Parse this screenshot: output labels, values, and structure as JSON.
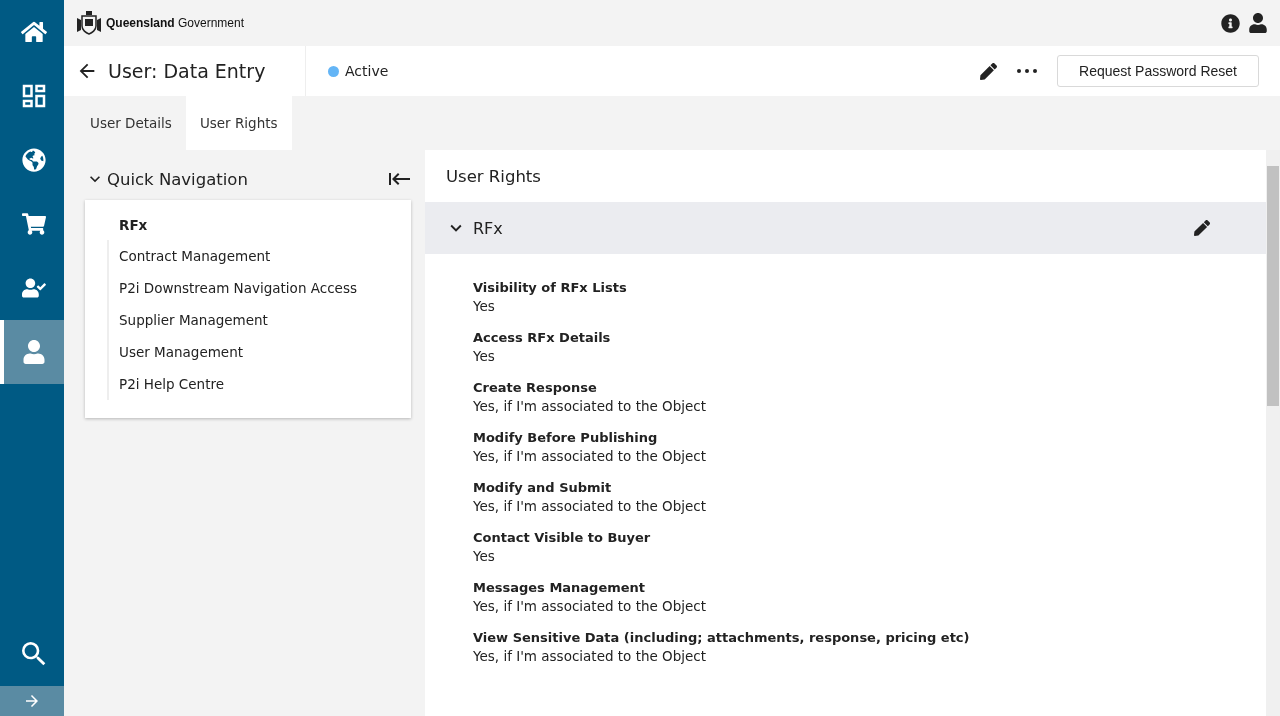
{
  "rail": {
    "items": [
      {
        "kind": "home",
        "selected": false
      },
      {
        "kind": "layout",
        "selected": false
      },
      {
        "kind": "globe",
        "selected": false
      },
      {
        "kind": "cart",
        "selected": false
      },
      {
        "kind": "user-check",
        "selected": false
      },
      {
        "kind": "user",
        "selected": true
      }
    ],
    "bottom": [
      {
        "kind": "search"
      }
    ]
  },
  "topbar": {
    "logo": "**Queensland** Government"
  },
  "header": {
    "title": "User: Data Entry",
    "status": "Active",
    "button": "Request Password Reset"
  },
  "tabs": [
    {
      "label": "User Details",
      "selected": false
    },
    {
      "label": "User Rights",
      "selected": true
    }
  ],
  "quick_nav": {
    "title": "Quick Navigation",
    "items": [
      {
        "label": "RFx",
        "selected": true
      },
      {
        "label": "Contract Management",
        "selected": false
      },
      {
        "label": "P2i Downstream Navigation Access",
        "selected": false
      },
      {
        "label": "Supplier Management",
        "selected": false
      },
      {
        "label": "User Management",
        "selected": false
      },
      {
        "label": "P2i Help Centre",
        "selected": false
      }
    ]
  },
  "panel": {
    "title": "User Rights",
    "section": {
      "title": "RFx",
      "expanded": true,
      "fields": [
        {
          "label": "Visibility of RFx Lists",
          "value": "Yes"
        },
        {
          "label": "Access RFx Details",
          "value": "Yes"
        },
        {
          "label": "Create Response",
          "value": "Yes, if I'm associated to the Object"
        },
        {
          "label": "Modify Before Publishing",
          "value": "Yes, if I'm associated to the Object"
        },
        {
          "label": "Modify and Submit",
          "value": "Yes, if I'm associated to the Object"
        },
        {
          "label": "Contact Visible to Buyer",
          "value": "Yes"
        },
        {
          "label": "Messages Management",
          "value": "Yes, if I'm associated to the Object"
        },
        {
          "label": "View Sensitive Data (including; attachments, response, pricing etc)",
          "value": "Yes, if I'm associated to the Object"
        }
      ]
    }
  }
}
